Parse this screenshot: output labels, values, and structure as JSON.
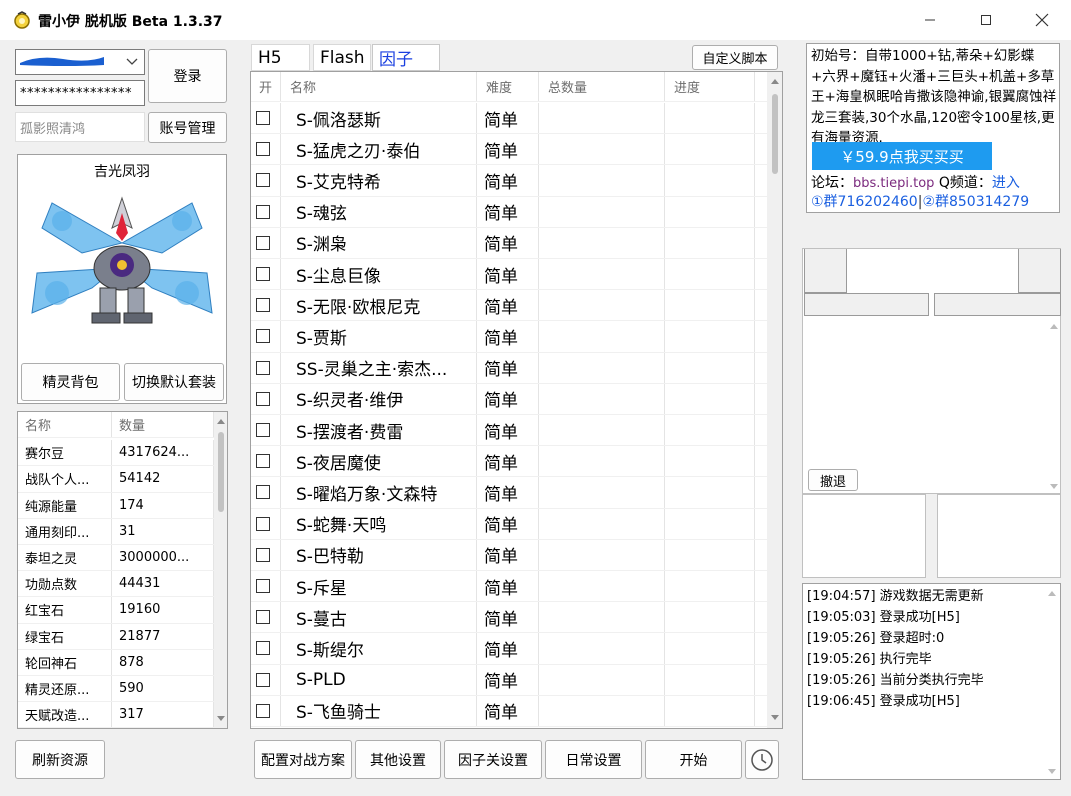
{
  "window": {
    "title": "雷小伊 脱机版 Beta 1.3.37"
  },
  "login": {
    "account_value": "",
    "password_value": "****************",
    "nickname_placeholder": "孤影照清鸿",
    "login_label": "登录",
    "account_manage_label": "账号管理"
  },
  "sprite": {
    "name": "吉光凤羽",
    "backpack_label": "精灵背包",
    "switch_suit_label": "切换默认套装"
  },
  "resources": {
    "headers": [
      "名称",
      "数量"
    ],
    "rows": [
      [
        "赛尔豆",
        "4317624..."
      ],
      [
        "战队个人...",
        "54142"
      ],
      [
        "纯源能量",
        "174"
      ],
      [
        "通用刻印...",
        "31"
      ],
      [
        "泰坦之灵",
        "3000000..."
      ],
      [
        "功勋点数",
        "44431"
      ],
      [
        "红宝石",
        "19160"
      ],
      [
        "绿宝石",
        "21877"
      ],
      [
        "轮回神石",
        "878"
      ],
      [
        "精灵还原...",
        "590"
      ],
      [
        "天赋改造...",
        "317"
      ]
    ],
    "refresh_label": "刷新资源"
  },
  "tabs": [
    "H5",
    "Flash",
    "因子"
  ],
  "active_tab": 2,
  "custom_script_label": "自定义脚本",
  "task_table": {
    "headers": [
      "开",
      "名称",
      "难度",
      "总数量",
      "进度"
    ],
    "rows": [
      [
        "S-佩洛瑟斯",
        "简单"
      ],
      [
        "S-猛虎之刃·泰伯",
        "简单"
      ],
      [
        "S-艾克特希",
        "简单"
      ],
      [
        "S-魂弦",
        "简单"
      ],
      [
        "S-渊枭",
        "简单"
      ],
      [
        "S-尘息巨像",
        "简单"
      ],
      [
        "S-无限·欧根尼克",
        "简单"
      ],
      [
        "S-贾斯",
        "简单"
      ],
      [
        "SS-灵巢之主·索杰...",
        "简单"
      ],
      [
        "S-织灵者·维伊",
        "简单"
      ],
      [
        "S-摆渡者·费雷",
        "简单"
      ],
      [
        "S-夜居魔使",
        "简单"
      ],
      [
        "S-曜焰万象·文森特",
        "简单"
      ],
      [
        "S-蛇舞·天鸣",
        "简单"
      ],
      [
        "S-巴特勒",
        "简单"
      ],
      [
        "S-斥星",
        "简单"
      ],
      [
        "S-蔓古",
        "简单"
      ],
      [
        "S-斯缇尔",
        "简单"
      ],
      [
        "S-PLD",
        "简单"
      ],
      [
        "S-飞鱼骑士",
        "简单"
      ]
    ]
  },
  "bottom_buttons": [
    "配置对战方案",
    "其他设置",
    "因子关设置",
    "日常设置",
    "开始"
  ],
  "ad": {
    "text": "初始号：自带1000+钻,蒂朵+幻影蝶+六界+魔钰+火潘+三巨头+机盖+多草王+海皇枫眠哈肯撒该隐神谕,银翼腐蚀祥龙三套装,30个水晶,120密令100星核,更有海量资源.",
    "buy_label": "￥59.9点我买买买",
    "forum_label": "论坛：",
    "forum_url": "bbs.tiepi.top",
    "qchannel_label": "Q频道：",
    "enter_label": "进入",
    "group1": "①群716202460",
    "group_sep": "|",
    "group2": "②群850314279",
    "accent_color": "#1e90ff"
  },
  "retreat_label": "撤退",
  "log": [
    "[19:04:57] 游戏数据无需更新",
    "[19:05:03] 登录成功[H5]",
    "[19:05:26] 登录超时:0",
    "[19:05:26]  执行完毕",
    "[19:05:26] 当前分类执行完毕",
    "[19:06:45] 登录成功[H5]"
  ]
}
